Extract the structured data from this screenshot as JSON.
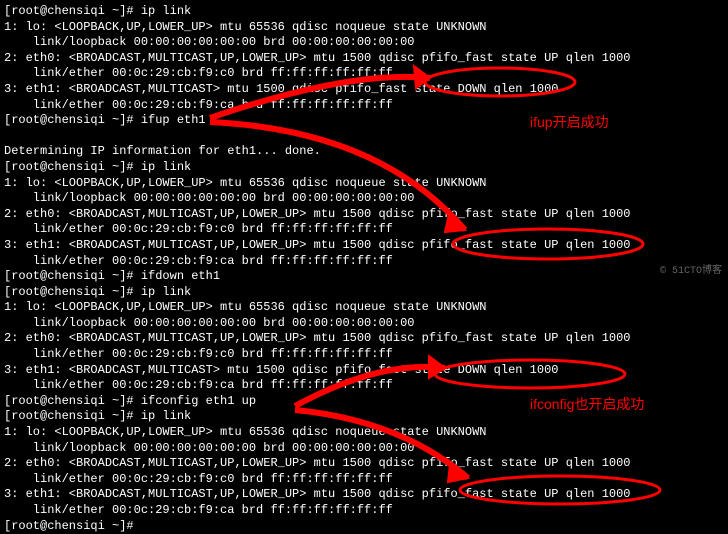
{
  "lines": [
    "[root@chensiqi ~]# ip link",
    "1: lo: <LOOPBACK,UP,LOWER_UP> mtu 65536 qdisc noqueue state UNKNOWN",
    "    link/loopback 00:00:00:00:00:00 brd 00:00:00:00:00:00",
    "2: eth0: <BROADCAST,MULTICAST,UP,LOWER_UP> mtu 1500 qdisc pfifo_fast state UP qlen 1000",
    "    link/ether 00:0c:29:cb:f9:c0 brd ff:ff:ff:ff:ff:ff",
    "3: eth1: <BROADCAST,MULTICAST> mtu 1500 qdisc pfifo_fast state DOWN qlen 1000",
    "    link/ether 00:0c:29:cb:f9:ca brd ff:ff:ff:ff:ff:ff",
    "[root@chensiqi ~]# ifup eth1",
    "",
    "Determining IP information for eth1... done.",
    "[root@chensiqi ~]# ip link",
    "1: lo: <LOOPBACK,UP,LOWER_UP> mtu 65536 qdisc noqueue state UNKNOWN",
    "    link/loopback 00:00:00:00:00:00 brd 00:00:00:00:00:00",
    "2: eth0: <BROADCAST,MULTICAST,UP,LOWER_UP> mtu 1500 qdisc pfifo_fast state UP qlen 1000",
    "    link/ether 00:0c:29:cb:f9:c0 brd ff:ff:ff:ff:ff:ff",
    "3: eth1: <BROADCAST,MULTICAST,UP,LOWER_UP> mtu 1500 qdisc pfifo_fast state UP qlen 1000",
    "    link/ether 00:0c:29:cb:f9:ca brd ff:ff:ff:ff:ff:ff",
    "[root@chensiqi ~]# ifdown eth1",
    "[root@chensiqi ~]# ip link",
    "1: lo: <LOOPBACK,UP,LOWER_UP> mtu 65536 qdisc noqueue state UNKNOWN",
    "    link/loopback 00:00:00:00:00:00 brd 00:00:00:00:00:00",
    "2: eth0: <BROADCAST,MULTICAST,UP,LOWER_UP> mtu 1500 qdisc pfifo_fast state UP qlen 1000",
    "    link/ether 00:0c:29:cb:f9:c0 brd ff:ff:ff:ff:ff:ff",
    "3: eth1: <BROADCAST,MULTICAST> mtu 1500 qdisc pfifo_fast state DOWN qlen 1000",
    "    link/ether 00:0c:29:cb:f9:ca brd ff:ff:ff:ff:ff:ff",
    "[root@chensiqi ~]# ifconfig eth1 up",
    "[root@chensiqi ~]# ip link",
    "1: lo: <LOOPBACK,UP,LOWER_UP> mtu 65536 qdisc noqueue state UNKNOWN",
    "    link/loopback 00:00:00:00:00:00 brd 00:00:00:00:00:00",
    "2: eth0: <BROADCAST,MULTICAST,UP,LOWER_UP> mtu 1500 qdisc pfifo_fast state UP qlen 1000",
    "    link/ether 00:0c:29:cb:f9:c0 brd ff:ff:ff:ff:ff:ff",
    "3: eth1: <BROADCAST,MULTICAST,UP,LOWER_UP> mtu 1500 qdisc pfifo_fast state UP qlen 1000",
    "    link/ether 00:0c:29:cb:f9:ca brd ff:ff:ff:ff:ff:ff",
    "[root@chensiqi ~]#"
  ],
  "annotations": {
    "ifup_success": "ifup开启成功",
    "ifconfig_success": "ifconfig也开启成功"
  },
  "watermark": "© 51CTO博客"
}
